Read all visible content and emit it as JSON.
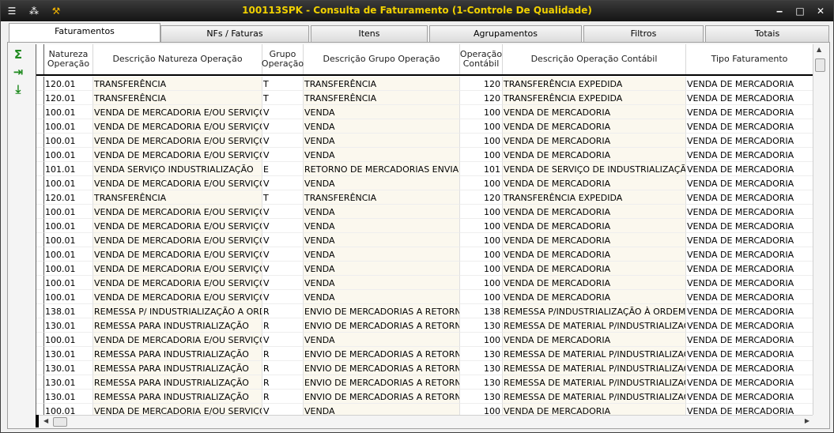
{
  "window": {
    "title": "100113SPK - Consulta de Faturamento (1-Controle De Qualidade)",
    "title_color": "#f0d000"
  },
  "tabs": [
    {
      "label": "Faturamentos",
      "active": true
    },
    {
      "label": "NFs / Faturas",
      "active": false
    },
    {
      "label": "Itens",
      "active": false
    },
    {
      "label": "Agrupamentos",
      "active": false
    },
    {
      "label": "Filtros",
      "active": false
    },
    {
      "label": "Totais",
      "active": false
    }
  ],
  "toolbar_icons": [
    "sum-icon",
    "export-icon",
    "download-icon"
  ],
  "grid": {
    "headers": {
      "natureza": "Natureza Operação",
      "desc_natureza": "Descrição Natureza Operação",
      "grupo": "Grupo Operação",
      "desc_grupo": "Descrição Grupo Operação",
      "op_contabil": "Operação Contábil",
      "desc_contabil": "Descrição Operação Contábil",
      "tipo": "Tipo Faturamento"
    },
    "rows": [
      [
        "120.01",
        "TRANSFERÊNCIA",
        "T",
        "TRANSFERÊNCIA",
        "120",
        "TRANSFERÊNCIA EXPEDIDA",
        "VENDA DE MERCADORIA"
      ],
      [
        "120.01",
        "TRANSFERÊNCIA",
        "T",
        "TRANSFERÊNCIA",
        "120",
        "TRANSFERÊNCIA EXPEDIDA",
        "VENDA DE MERCADORIA"
      ],
      [
        "100.01",
        "VENDA DE MERCADORIA E/OU SERVIÇOS",
        "V",
        "VENDA",
        "100",
        "VENDA DE MERCADORIA",
        "VENDA DE MERCADORIA"
      ],
      [
        "100.01",
        "VENDA DE MERCADORIA E/OU SERVIÇOS",
        "V",
        "VENDA",
        "100",
        "VENDA DE MERCADORIA",
        "VENDA DE MERCADORIA"
      ],
      [
        "100.01",
        "VENDA DE MERCADORIA E/OU SERVIÇOS",
        "V",
        "VENDA",
        "100",
        "VENDA DE MERCADORIA",
        "VENDA DE MERCADORIA"
      ],
      [
        "100.01",
        "VENDA DE MERCADORIA E/OU SERVIÇOS",
        "V",
        "VENDA",
        "100",
        "VENDA DE MERCADORIA",
        "VENDA DE MERCADORIA"
      ],
      [
        "101.01",
        "VENDA SERVIÇO INDUSTRIALIZAÇÃO",
        "E",
        "RETORNO DE MERCADORIAS ENVIADAS",
        "101",
        "VENDA DE SERVIÇO DE INDUSTRIALIZAÇÃO",
        "VENDA DE MERCADORIA"
      ],
      [
        "100.01",
        "VENDA DE MERCADORIA E/OU SERVIÇOS",
        "V",
        "VENDA",
        "100",
        "VENDA DE MERCADORIA",
        "VENDA DE MERCADORIA"
      ],
      [
        "120.01",
        "TRANSFERÊNCIA",
        "T",
        "TRANSFERÊNCIA",
        "120",
        "TRANSFERÊNCIA EXPEDIDA",
        "VENDA DE MERCADORIA"
      ],
      [
        "100.01",
        "VENDA DE MERCADORIA E/OU SERVIÇOS",
        "V",
        "VENDA",
        "100",
        "VENDA DE MERCADORIA",
        "VENDA DE MERCADORIA"
      ],
      [
        "100.01",
        "VENDA DE MERCADORIA E/OU SERVIÇOS",
        "V",
        "VENDA",
        "100",
        "VENDA DE MERCADORIA",
        "VENDA DE MERCADORIA"
      ],
      [
        "100.01",
        "VENDA DE MERCADORIA E/OU SERVIÇOS",
        "V",
        "VENDA",
        "100",
        "VENDA DE MERCADORIA",
        "VENDA DE MERCADORIA"
      ],
      [
        "100.01",
        "VENDA DE MERCADORIA E/OU SERVIÇOS",
        "V",
        "VENDA",
        "100",
        "VENDA DE MERCADORIA",
        "VENDA DE MERCADORIA"
      ],
      [
        "100.01",
        "VENDA DE MERCADORIA E/OU SERVIÇOS",
        "V",
        "VENDA",
        "100",
        "VENDA DE MERCADORIA",
        "VENDA DE MERCADORIA"
      ],
      [
        "100.01",
        "VENDA DE MERCADORIA E/OU SERVIÇOS",
        "V",
        "VENDA",
        "100",
        "VENDA DE MERCADORIA",
        "VENDA DE MERCADORIA"
      ],
      [
        "100.01",
        "VENDA DE MERCADORIA E/OU SERVIÇOS",
        "V",
        "VENDA",
        "100",
        "VENDA DE MERCADORIA",
        "VENDA DE MERCADORIA"
      ],
      [
        "138.01",
        "REMESSA P/ INDUSTRIALIZAÇÃO A ORDEM",
        "R",
        "ENVIO DE MERCADORIAS A RETORNAR",
        "138",
        "REMESSA P/INDUSTRIALIZAÇÃO À ORDEM",
        "VENDA DE MERCADORIA"
      ],
      [
        "130.01",
        "REMESSA PARA INDUSTRIALIZAÇÃO",
        "R",
        "ENVIO DE MERCADORIAS A RETORNAR",
        "130",
        "REMESSA DE MATERIAL P/INDUSTRIALIZAÇÃO",
        "VENDA DE MERCADORIA"
      ],
      [
        "100.01",
        "VENDA DE MERCADORIA E/OU SERVIÇOS",
        "V",
        "VENDA",
        "100",
        "VENDA DE MERCADORIA",
        "VENDA DE MERCADORIA"
      ],
      [
        "130.01",
        "REMESSA PARA INDUSTRIALIZAÇÃO",
        "R",
        "ENVIO DE MERCADORIAS A RETORNAR",
        "130",
        "REMESSA DE MATERIAL P/INDUSTRIALIZAÇÃO",
        "VENDA DE MERCADORIA"
      ],
      [
        "130.01",
        "REMESSA PARA INDUSTRIALIZAÇÃO",
        "R",
        "ENVIO DE MERCADORIAS A RETORNAR",
        "130",
        "REMESSA DE MATERIAL P/INDUSTRIALIZAÇÃO",
        "VENDA DE MERCADORIA"
      ],
      [
        "130.01",
        "REMESSA PARA INDUSTRIALIZAÇÃO",
        "R",
        "ENVIO DE MERCADORIAS A RETORNAR",
        "130",
        "REMESSA DE MATERIAL P/INDUSTRIALIZAÇÃO",
        "VENDA DE MERCADORIA"
      ],
      [
        "130.01",
        "REMESSA PARA INDUSTRIALIZAÇÃO",
        "R",
        "ENVIO DE MERCADORIAS A RETORNAR",
        "130",
        "REMESSA DE MATERIAL P/INDUSTRIALIZAÇÃO",
        "VENDA DE MERCADORIA"
      ],
      [
        "100.01",
        "VENDA DE MERCADORIA E/OU SERVIÇOS",
        "V",
        "VENDA",
        "100",
        "VENDA DE MERCADORIA",
        "VENDA DE MERCADORIA"
      ]
    ]
  }
}
